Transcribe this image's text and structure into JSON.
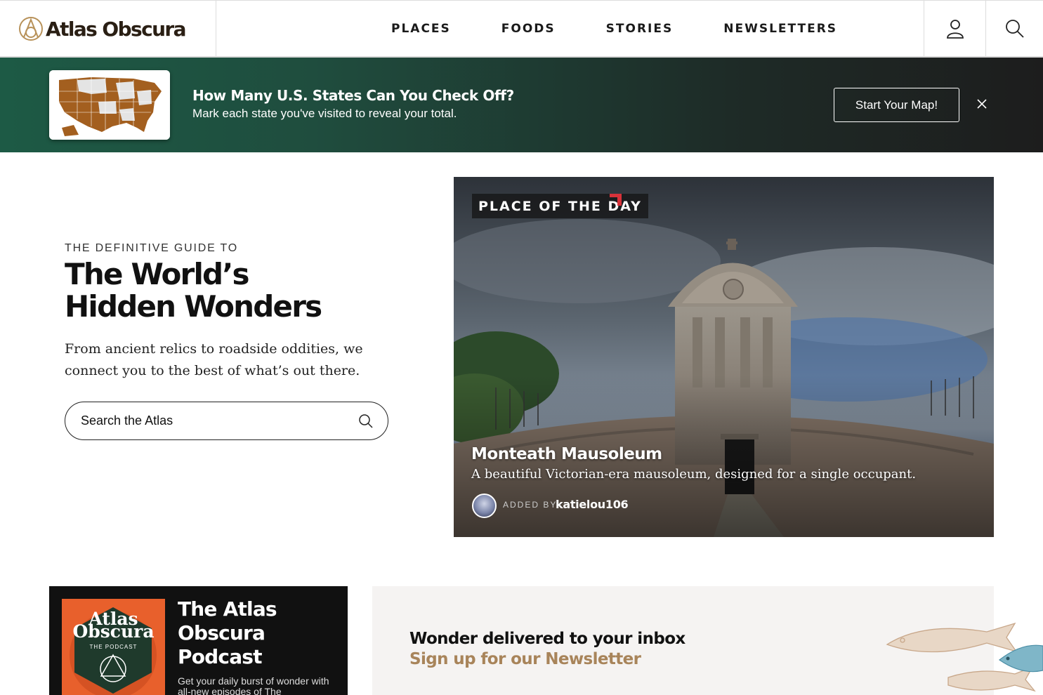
{
  "header": {
    "logo_text": "Atlas Obscura",
    "nav": [
      "PLACES",
      "FOODS",
      "STORIES",
      "NEWSLETTERS"
    ],
    "icons": [
      "user-icon",
      "search-icon"
    ]
  },
  "banner": {
    "title": "How Many U.S. States Can You Check Off?",
    "subtitle": "Mark each state you've visited to reveal your total.",
    "button": "Start Your Map!",
    "close_icon": "close-icon"
  },
  "hero": {
    "eyebrow": "THE DEFINITIVE GUIDE TO",
    "title_line1": "The World’s",
    "title_line2": "Hidden Wonders",
    "description": "From ancient relics to roadside oddities, we connect you to the best of what’s out there.",
    "search_placeholder": "Search the Atlas"
  },
  "place_of_the_day": {
    "tag": "PLACE OF THE DAY",
    "name": "Monteath Mausoleum",
    "description": "A beautiful Victorian-era mausoleum, designed for a single occupant.",
    "added_by_label": "ADDED BY",
    "user": "katielou106"
  },
  "podcast": {
    "art_title_1": "Atlas",
    "art_title_2": "Obscura",
    "art_sub": "THE PODCAST",
    "title": "The Atlas Obscura Podcast",
    "description": "Get your daily burst of wonder with all-new episodes of The"
  },
  "newsletter": {
    "title": "Wonder delivered to your inbox",
    "link": "Sign up for our Newsletter"
  },
  "colors": {
    "brand_dark": "#2a1f14",
    "banner_green": "#1d5a45",
    "accent_red": "#d8323a",
    "newsletter_gold": "#a8845a",
    "podcast_orange": "#e8602c"
  }
}
